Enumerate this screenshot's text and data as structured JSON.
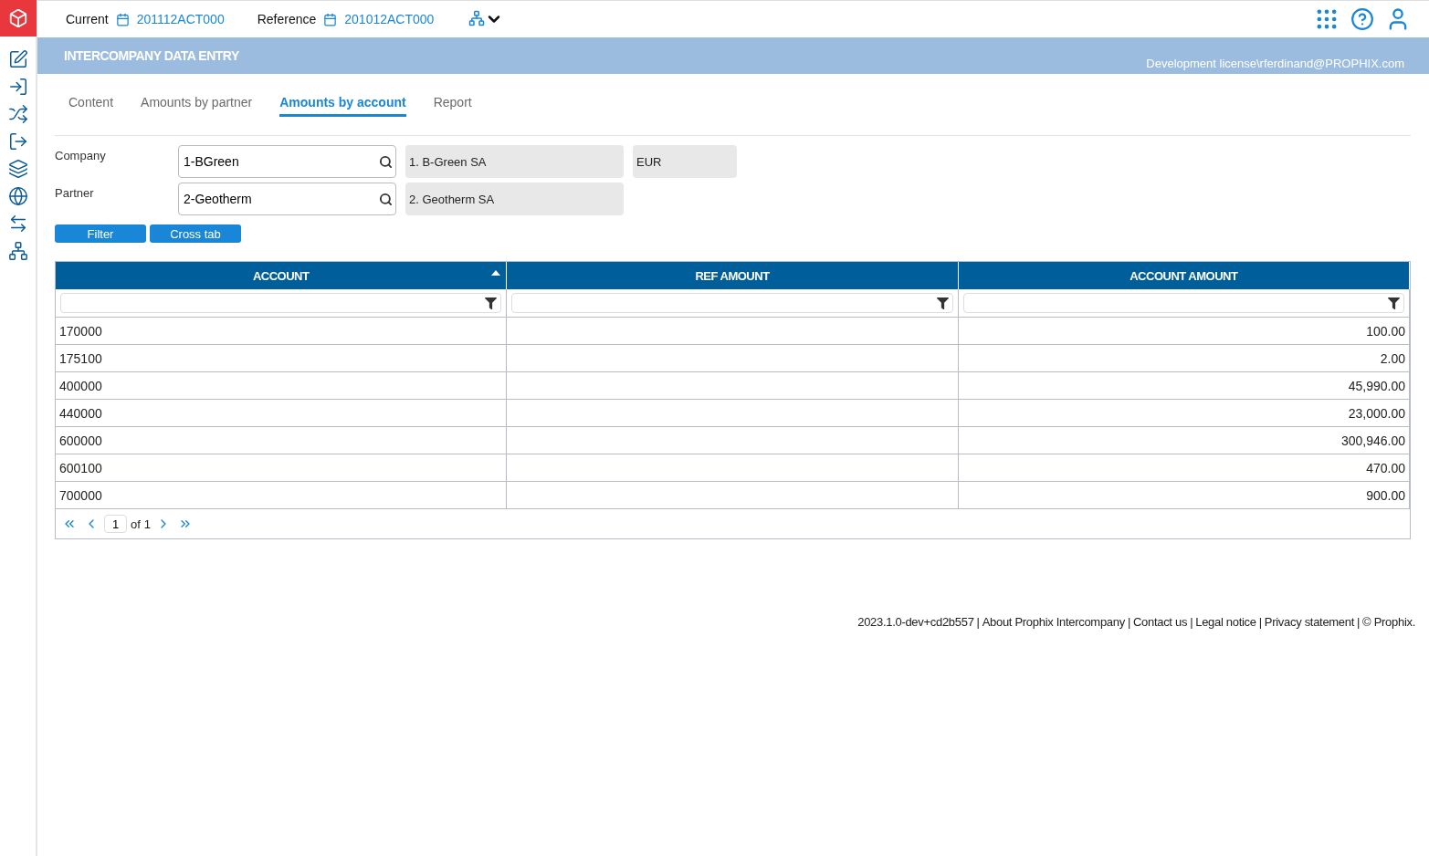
{
  "topbar": {
    "current_label": "Current",
    "current_value": "201112ACT000",
    "reference_label": "Reference",
    "reference_value": "201012ACT000"
  },
  "banner": {
    "title": "INTERCOMPANY DATA ENTRY",
    "license": "Development license\\rferdinand@PROPHIX.com"
  },
  "tabs": [
    {
      "label": "Content",
      "selected": false
    },
    {
      "label": "Amounts by partner",
      "selected": false
    },
    {
      "label": "Amounts by account",
      "selected": true
    },
    {
      "label": "Report",
      "selected": false
    }
  ],
  "filters": [
    {
      "label": "Company",
      "value": "1-BGreen",
      "name": "1. B-Green SA",
      "currency": "EUR"
    },
    {
      "label": "Partner",
      "value": "2-Geotherm",
      "name": "2. Geotherm SA"
    }
  ],
  "buttons": [
    "Filter",
    "Cross tab"
  ],
  "table": {
    "columns": [
      {
        "title": "ACCOUNT",
        "sorted": true,
        "kind": "code"
      },
      {
        "title": "REF AMOUNT",
        "sorted": false,
        "kind": "amount"
      },
      {
        "title": "ACCOUNT AMOUNT",
        "sorted": false,
        "kind": "amount"
      }
    ],
    "rows": [
      [
        "170000",
        "",
        "100.00"
      ],
      [
        "175100",
        "",
        "2.00"
      ],
      [
        "400000",
        "",
        "45,990.00"
      ],
      [
        "440000",
        "",
        "23,000.00"
      ],
      [
        "600000",
        "",
        "300,946.00"
      ],
      [
        "600100",
        "",
        "470.00"
      ],
      [
        "700000",
        "",
        "900.00"
      ]
    ]
  },
  "pagination": {
    "page": "1",
    "of_label": "of",
    "total": "1"
  },
  "footer": {
    "separator": "|",
    "items": [
      "2023.1.0-dev+cd2b557",
      "About Prophix Intercompany",
      "Contact us",
      "Legal notice",
      "Privacy statement",
      "© Prophix."
    ]
  }
}
